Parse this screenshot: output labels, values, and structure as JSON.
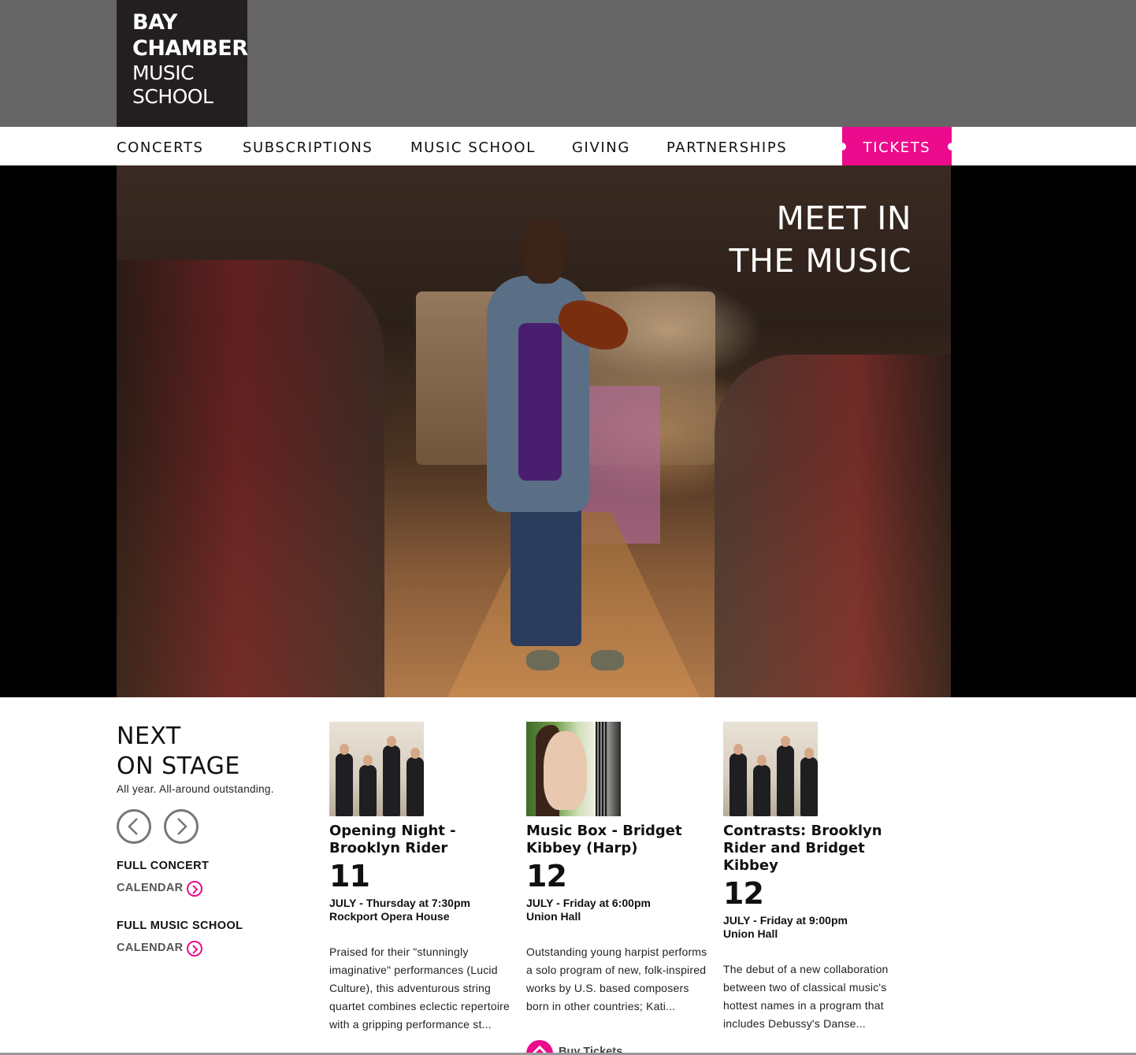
{
  "logo": {
    "line1": "BAY",
    "line2": "CHAMBER",
    "line3": "MUSIC",
    "line4": "SCHOOL"
  },
  "nav": {
    "items": [
      "CONCERTS",
      "SUBSCRIPTIONS",
      "MUSIC SCHOOL",
      "GIVING",
      "PARTNERSHIPS"
    ],
    "tickets": "TICKETS"
  },
  "hero": {
    "headline_line1": "MEET IN",
    "headline_line2": "THE MUSIC"
  },
  "next_on_stage": {
    "title_line1": "NEXT",
    "title_line2": "ON STAGE",
    "subtitle": "All year. All-around outstanding.",
    "links": [
      {
        "line1": "FULL CONCERT",
        "line2": "CALENDAR"
      },
      {
        "line1": "FULL MUSIC SCHOOL",
        "line2": "CALENDAR"
      }
    ]
  },
  "events": [
    {
      "title": "Opening Night - Brooklyn Rider",
      "day": "11",
      "when": "JULY - Thursday at 7:30pm",
      "venue": "Rockport Opera House",
      "description": "Praised for their \"stunningly imaginative\" performances (Lucid Culture), this adventurous string quartet combines eclectic repertoire with a gripping performance st..."
    },
    {
      "title": "Music Box - Bridget Kibbey (Harp)",
      "day": "12",
      "when": "JULY - Friday at 6:00pm",
      "venue": "Union Hall",
      "description": "Outstanding young harpist performs a solo program of new, folk-inspired works by U.S. based composers born in other countries; Kati...",
      "buy_label": "Buy Tickets"
    },
    {
      "title": "Contrasts: Brooklyn Rider and Bridget Kibbey",
      "day": "12",
      "when": "JULY - Friday at 9:00pm",
      "venue": "Union Hall",
      "description": "The debut of a new collaboration between two of classical music's hottest names in a program that includes Debussy's Danse..."
    }
  ],
  "colors": {
    "accent": "#ec0b8c",
    "header_band": "#666666",
    "logo_bg": "#231f20"
  },
  "icons": {
    "prev": "chevron-left-icon",
    "next": "chevron-right-icon",
    "calendar_go": "chevron-right-circle-icon",
    "buy": "home-icon"
  }
}
